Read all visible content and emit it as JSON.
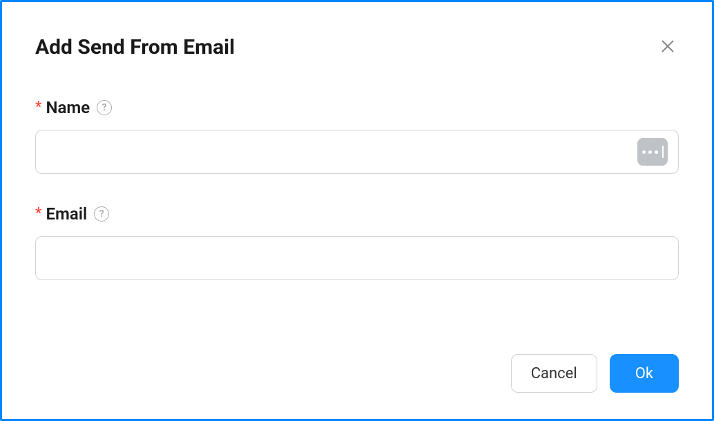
{
  "modal": {
    "title": "Add Send From Email",
    "fields": {
      "name": {
        "label": "Name",
        "value": ""
      },
      "email": {
        "label": "Email",
        "value": ""
      }
    },
    "buttons": {
      "cancel": "Cancel",
      "ok": "Ok"
    }
  }
}
